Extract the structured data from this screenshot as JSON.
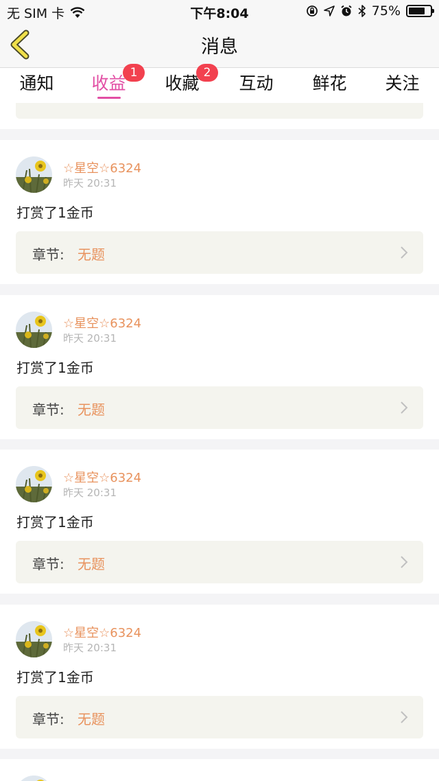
{
  "status_bar": {
    "carrier": "无 SIM 卡",
    "time": "下午8:04",
    "battery": "75%",
    "battery_level": 0.75,
    "icons": [
      "wifi-icon",
      "orientation-lock-icon",
      "location-arrow-icon",
      "alarm-icon",
      "bluetooth-icon",
      "battery-icon"
    ]
  },
  "nav": {
    "title": "消息",
    "back_icon": "chevron-left-icon"
  },
  "tabs": [
    {
      "label": "通知",
      "badge": "",
      "active": false
    },
    {
      "label": "收益",
      "badge": "1",
      "active": true
    },
    {
      "label": "收藏",
      "badge": "2",
      "active": false
    },
    {
      "label": "互动",
      "badge": "",
      "active": false
    },
    {
      "label": "鲜花",
      "badge": "",
      "active": false
    },
    {
      "label": "关注",
      "badge": "",
      "active": false
    }
  ],
  "messages": [
    {
      "username": "☆星空☆6324",
      "time": "昨天 20:31",
      "text": "打赏了1金币",
      "chapter_label": "章节:",
      "chapter_value": "无题"
    },
    {
      "username": "☆星空☆6324",
      "time": "昨天 20:31",
      "text": "打赏了1金币",
      "chapter_label": "章节:",
      "chapter_value": "无题"
    },
    {
      "username": "☆星空☆6324",
      "time": "昨天 20:31",
      "text": "打赏了1金币",
      "chapter_label": "章节:",
      "chapter_value": "无题"
    },
    {
      "username": "☆星空☆6324",
      "time": "昨天 20:31",
      "text": "打赏了1金币",
      "chapter_label": "章节:",
      "chapter_value": "无题"
    }
  ],
  "colors": {
    "accent": "#e24ea4",
    "badge": "#f2414f",
    "username": "#e8925d",
    "chapter_value": "#e8925d",
    "back_arrow": "#f0e04a"
  }
}
